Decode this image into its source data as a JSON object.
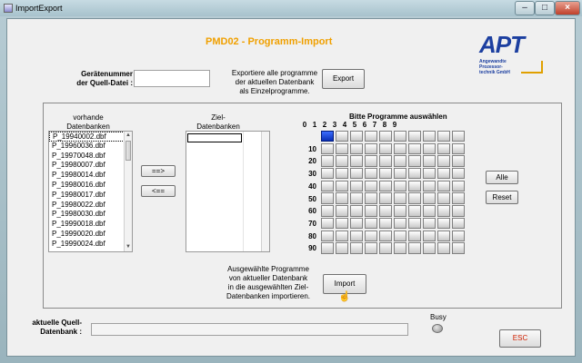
{
  "window": {
    "title": "ImportExport"
  },
  "heading": "PMD02 - Programm-Import",
  "logo": {
    "big": "APT",
    "line1": "Angewandte",
    "line2": "Prozessor-",
    "line3": "technik GmbH",
    "color": "#1c3fa0"
  },
  "device": {
    "label_line1": "Gerätenummer",
    "label_line2": "der Quell-Datei :",
    "value": ""
  },
  "export": {
    "desc_line1": "Exportiere alle programme",
    "desc_line2": "der aktuellen Datenbank",
    "desc_line3": "als Einzelprogramme.",
    "button": "Export"
  },
  "source": {
    "header_line1": "vorhande",
    "header_line2": "Datenbanken",
    "items": [
      "P_19940002.dbf",
      "P_19960036.dbf",
      "P_19970048.dbf",
      "P_19980007.dbf",
      "P_19980014.dbf",
      "P_19980016.dbf",
      "P_19980017.dbf",
      "P_19980022.dbf",
      "P_19980030.dbf",
      "P_19990018.dbf",
      "P_19990020.dbf",
      "P_19990024.dbf"
    ],
    "selected_index": 0
  },
  "move": {
    "right": "==>",
    "left": "<=="
  },
  "target": {
    "header_line1": "Ziel-",
    "header_line2": "Datenbanken"
  },
  "programs": {
    "header": "Bitte Programme auswählen",
    "col_labels": [
      "0",
      "1",
      "2",
      "3",
      "4",
      "5",
      "6",
      "7",
      "8",
      "9"
    ],
    "row_labels": [
      "",
      "10",
      "20",
      "30",
      "40",
      "50",
      "60",
      "70",
      "80",
      "90"
    ],
    "selected": [
      0
    ],
    "accent": "#1a3fd0"
  },
  "buttons": {
    "all": "Alle",
    "reset": "Reset"
  },
  "import": {
    "desc_line1": "Ausgewählte Programme",
    "desc_line2": "von aktueller Datenbank",
    "desc_line3": "in die ausgewählten Ziel-",
    "desc_line4": "Datenbanken importieren.",
    "button": "Import"
  },
  "current": {
    "label_line1": "aktuelle Quell-",
    "label_line2": "Datenbank :",
    "value": ""
  },
  "busy": {
    "label": "Busy"
  },
  "esc": {
    "label": "ESC",
    "color": "#d02000"
  }
}
